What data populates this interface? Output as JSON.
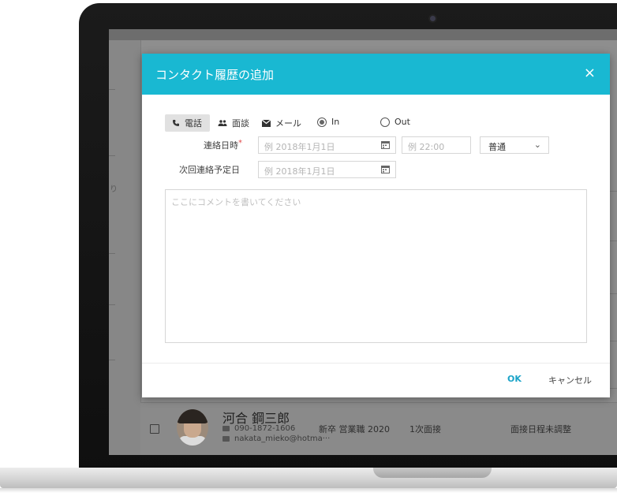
{
  "modal": {
    "title": "コンタクト履歴の追加",
    "close_label": "×",
    "contact_types": [
      {
        "label": "電話",
        "icon": "phone-icon",
        "selected": true
      },
      {
        "label": "面談",
        "icon": "people-icon",
        "selected": false
      },
      {
        "label": "メール",
        "icon": "mail-icon",
        "selected": false
      }
    ],
    "direction": [
      {
        "label": "In",
        "checked": true
      },
      {
        "label": "Out",
        "checked": false
      }
    ],
    "contact_datetime": {
      "label": "連絡日時",
      "required_mark": "*",
      "date_placeholder": "例 2018年1月1日",
      "time_placeholder": "例 22:00",
      "priority_value": "普通"
    },
    "next_contact": {
      "label": "次回連絡予定日",
      "date_placeholder": "例 2018年1月1日"
    },
    "comment_placeholder": "ここにコメントを書いてください",
    "ok_label": "OK",
    "cancel_label": "キャンセル"
  },
  "background_row": {
    "name": "河合 鋼三郎",
    "phone": "090-1872-1606",
    "email": "nakata_mieko@hotma···",
    "category": "新卒 営業職 2020",
    "stage": "1次面接",
    "status": "面接日程未調整"
  },
  "colors": {
    "header": "#19b8d2",
    "ok_text": "#1aa3c8",
    "required": "#e04a4a"
  }
}
